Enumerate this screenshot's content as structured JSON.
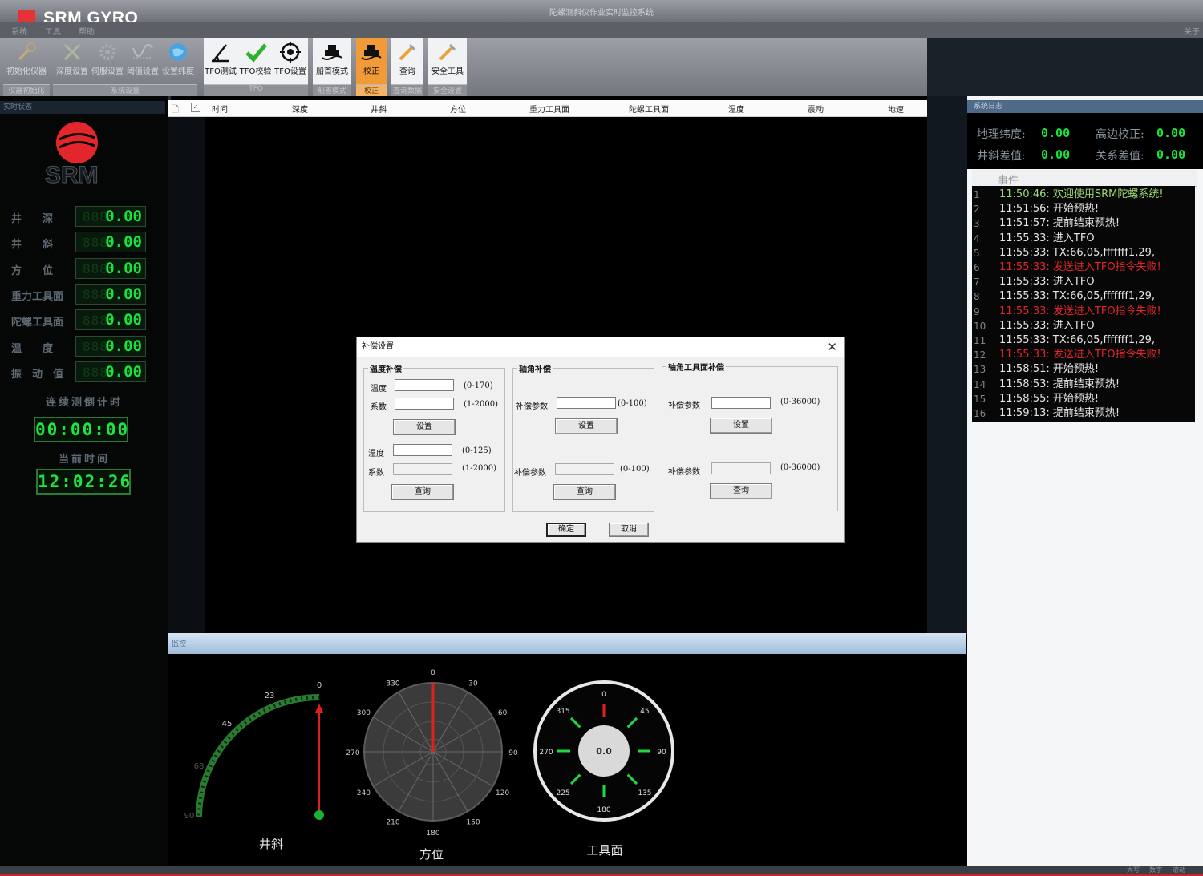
{
  "app": {
    "window_title": "陀螺测斜仪作业实时监控系统",
    "brand": "SRM GYRO",
    "logo_text": "SRM",
    "menu": [
      "系统",
      "工具",
      "帮助"
    ],
    "help_label": "关于"
  },
  "toolbar": {
    "groups": [
      {
        "label": "仪器初始化",
        "items": [
          "初始化仪器"
        ]
      },
      {
        "label": "系统设置",
        "items": [
          "深度设置",
          "伺服设置",
          "阈值设置",
          "设置纬度"
        ]
      },
      {
        "label": "TFO",
        "items": [
          "TFO测试",
          "TFO校验",
          "TFO设置"
        ]
      },
      {
        "label": "船首模式",
        "items": [
          "船首模式"
        ]
      },
      {
        "label": "校正",
        "items": [
          "校正"
        ]
      },
      {
        "label": "查询数据",
        "items": [
          "查询"
        ]
      },
      {
        "label": "安全设置",
        "items": [
          "安全工具"
        ]
      }
    ]
  },
  "left_panel": {
    "header": "实时状态",
    "meters": [
      {
        "label": "井　　深",
        "value": "0.00"
      },
      {
        "label": "井　　斜",
        "value": "0.00"
      },
      {
        "label": "方　　位",
        "value": "0.00"
      },
      {
        "label": "重力工具面",
        "value": "0.00"
      },
      {
        "label": "陀螺工具面",
        "value": "0.00"
      },
      {
        "label": "温　　度",
        "value": "0.00"
      },
      {
        "label": "振　动　值",
        "value": "0.00"
      }
    ],
    "timer_label": "连续测倒计时",
    "timer_value": "00:00:00",
    "clock_label": "当前时间",
    "clock_value": "12:02:26"
  },
  "table": {
    "columns": [
      "时间",
      "深度",
      "井斜",
      "方位",
      "重力工具面",
      "陀螺工具面",
      "温度",
      "震动",
      "地速"
    ]
  },
  "monitor": {
    "header": "监控",
    "inclination": {
      "label": "井斜",
      "ticks": [
        "0",
        "23",
        "45",
        "68",
        "90"
      ],
      "value": 0
    },
    "azimuth": {
      "label": "方位",
      "ticks": [
        "0",
        "30",
        "60",
        "90",
        "120",
        "150",
        "180",
        "210",
        "240",
        "270",
        "300",
        "330"
      ],
      "value": 0
    },
    "toolface": {
      "label": "工具面",
      "ticks": [
        "0",
        "45",
        "90",
        "135",
        "180",
        "225",
        "270",
        "315"
      ],
      "center_value": "0.0"
    }
  },
  "right_panel": {
    "header": "系统日志",
    "stats": [
      {
        "label": "地理纬度:",
        "value": "0.00"
      },
      {
        "label": "高边校正:",
        "value": "0.00"
      },
      {
        "label": "井斜差值:",
        "value": "0.00"
      },
      {
        "label": "关系差值:",
        "value": "0.00"
      }
    ],
    "events_header": "事件",
    "events": [
      {
        "n": "1",
        "text": "11:50:46: 欢迎使用SRM陀螺系统!",
        "color": "#9bd873"
      },
      {
        "n": "2",
        "text": "11:51:56: 开始预热!",
        "color": "#e6e6e6"
      },
      {
        "n": "3",
        "text": "11:51:57: 提前结束预热!",
        "color": "#e6e6e6"
      },
      {
        "n": "4",
        "text": "11:55:33: 进入TFO",
        "color": "#e6e6e6"
      },
      {
        "n": "5",
        "text": "11:55:33: TX:66,05,fffffff1,29,",
        "color": "#e6e6e6"
      },
      {
        "n": "6",
        "text": "11:55:33: 发送进入TFO指令失败!",
        "color": "#e0262a"
      },
      {
        "n": "7",
        "text": "11:55:33: 进入TFO",
        "color": "#e6e6e6"
      },
      {
        "n": "8",
        "text": "11:55:33: TX:66,05,fffffff1,29,",
        "color": "#e6e6e6"
      },
      {
        "n": "9",
        "text": "11:55:33: 发送进入TFO指令失败!",
        "color": "#e0262a"
      },
      {
        "n": "10",
        "text": "11:55:33: 进入TFO",
        "color": "#e6e6e6"
      },
      {
        "n": "11",
        "text": "11:55:33: TX:66,05,fffffff1,29,",
        "color": "#e6e6e6"
      },
      {
        "n": "12",
        "text": "11:55:33: 发送进入TFO指令失败!",
        "color": "#e0262a"
      },
      {
        "n": "13",
        "text": "11:58:51: 开始预热!",
        "color": "#e6e6e6"
      },
      {
        "n": "14",
        "text": "11:58:53: 提前结束预热!",
        "color": "#e6e6e6"
      },
      {
        "n": "15",
        "text": "11:58:55: 开始预热!",
        "color": "#e6e6e6"
      },
      {
        "n": "16",
        "text": "11:59:13: 提前结束预热!",
        "color": "#e6e6e6"
      }
    ]
  },
  "status_bar": [
    "大写",
    "数字",
    "滚动"
  ],
  "dialog": {
    "title": "补偿设置",
    "close": "✕",
    "temp_group": {
      "legend": "温度补偿",
      "temp_label": "温度",
      "temp_range": "(0-170)",
      "coef_label": "系数",
      "coef_range": "(1-2000)",
      "set_button": "设置",
      "temp2_label": "温度",
      "temp2_range": "(0-125)",
      "coef2_label": "系数",
      "coef2_range": "(1-2000)",
      "query_button": "查询"
    },
    "axis_group": {
      "legend": "轴角补偿",
      "param_label": "补偿参数",
      "param_range": "(0-100)",
      "set_button": "设置",
      "param2_label": "补偿参数",
      "param2_range": "(0-100)",
      "query_button": "查询"
    },
    "tf_group": {
      "legend": "轴角工具面补偿",
      "param_label": "补偿参数",
      "param_range": "(0-36000)",
      "set_button": "设置",
      "param2_label": "补偿参数",
      "param2_range": "(0-36000)",
      "query_button": "查询"
    },
    "ok_button": "确定",
    "cancel_button": "取消"
  },
  "colors": {
    "led_green": "#18e33b",
    "brand_red": "#e53236",
    "active_orange": "#f29a38"
  }
}
